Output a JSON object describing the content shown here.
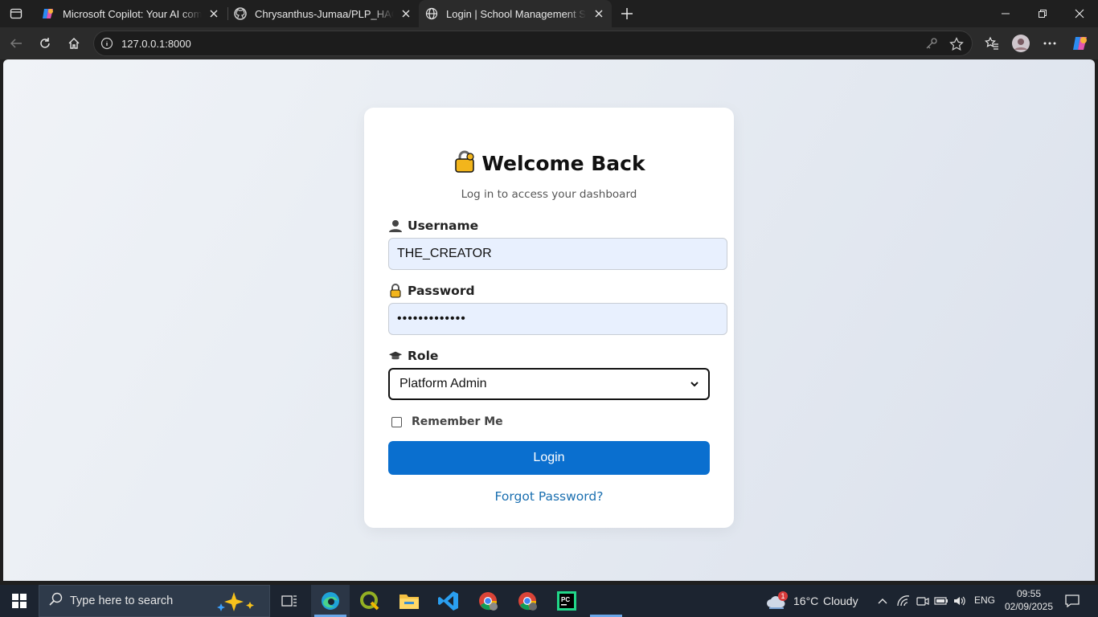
{
  "browser": {
    "tabs": [
      {
        "title": "Microsoft Copilot: Your AI companion",
        "active": false
      },
      {
        "title": "Chrysanthus-Jumaa/PLP_HACKATHON",
        "active": false
      },
      {
        "title": "Login | School Management System",
        "active": true
      }
    ],
    "url": "127.0.0.1:8000"
  },
  "page": {
    "title": "Welcome Back",
    "subtitle": "Log in to access your dashboard",
    "username": {
      "label": "Username",
      "value": "THE_CREATOR"
    },
    "password": {
      "label": "Password",
      "value": "•••••••••••••"
    },
    "role": {
      "label": "Role",
      "selected": "Platform Admin"
    },
    "remember_label": "Remember Me",
    "login_label": "Login",
    "forgot_label": "Forgot Password?"
  },
  "taskbar": {
    "search_placeholder": "Type here to search",
    "weather": {
      "temp": "16°C",
      "condition": "Cloudy",
      "badge": "1"
    },
    "language": "ENG",
    "time": "09:55",
    "date": "02/09/2025"
  },
  "colors": {
    "accent": "#0a6fcf",
    "link": "#1a6fb0",
    "input_fill": "#e8f0fe"
  }
}
